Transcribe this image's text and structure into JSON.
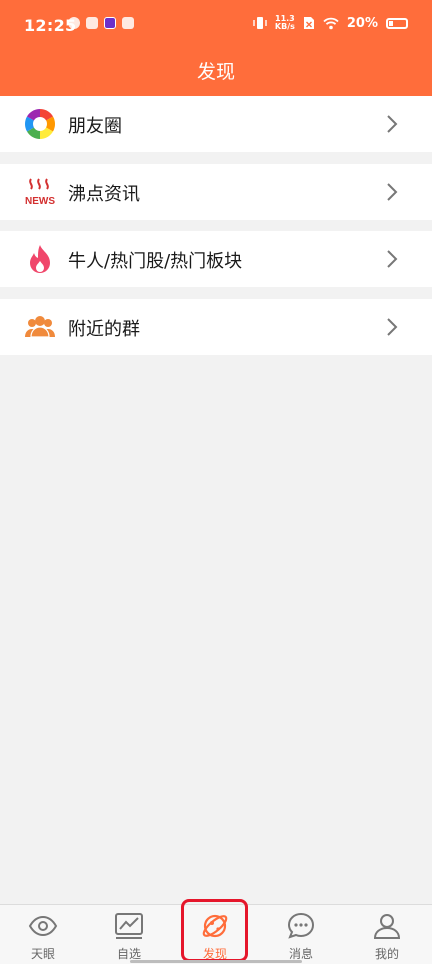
{
  "status_bar": {
    "time": "12:25",
    "net_speed_value": "11.3",
    "net_speed_unit": "KB/s",
    "battery": "20%"
  },
  "header": {
    "title": "发现"
  },
  "menu": {
    "items": [
      {
        "label": "朋友圈",
        "icon": "camera-aperture-icon"
      },
      {
        "label": "沸点资讯",
        "icon": "news-icon"
      },
      {
        "label": "牛人/热门股/热门板块",
        "icon": "flame-icon"
      },
      {
        "label": "附近的群",
        "icon": "group-people-icon"
      }
    ]
  },
  "tabs": [
    {
      "label": "天眼",
      "icon": "eye-icon",
      "active": false
    },
    {
      "label": "自选",
      "icon": "chart-icon",
      "active": false
    },
    {
      "label": "发现",
      "icon": "planet-icon",
      "active": true
    },
    {
      "label": "消息",
      "icon": "chat-bubble-icon",
      "active": false
    },
    {
      "label": "我的",
      "icon": "user-icon",
      "active": false
    }
  ],
  "colors": {
    "accent": "#ff6d3b",
    "highlight": "#e5162b"
  }
}
